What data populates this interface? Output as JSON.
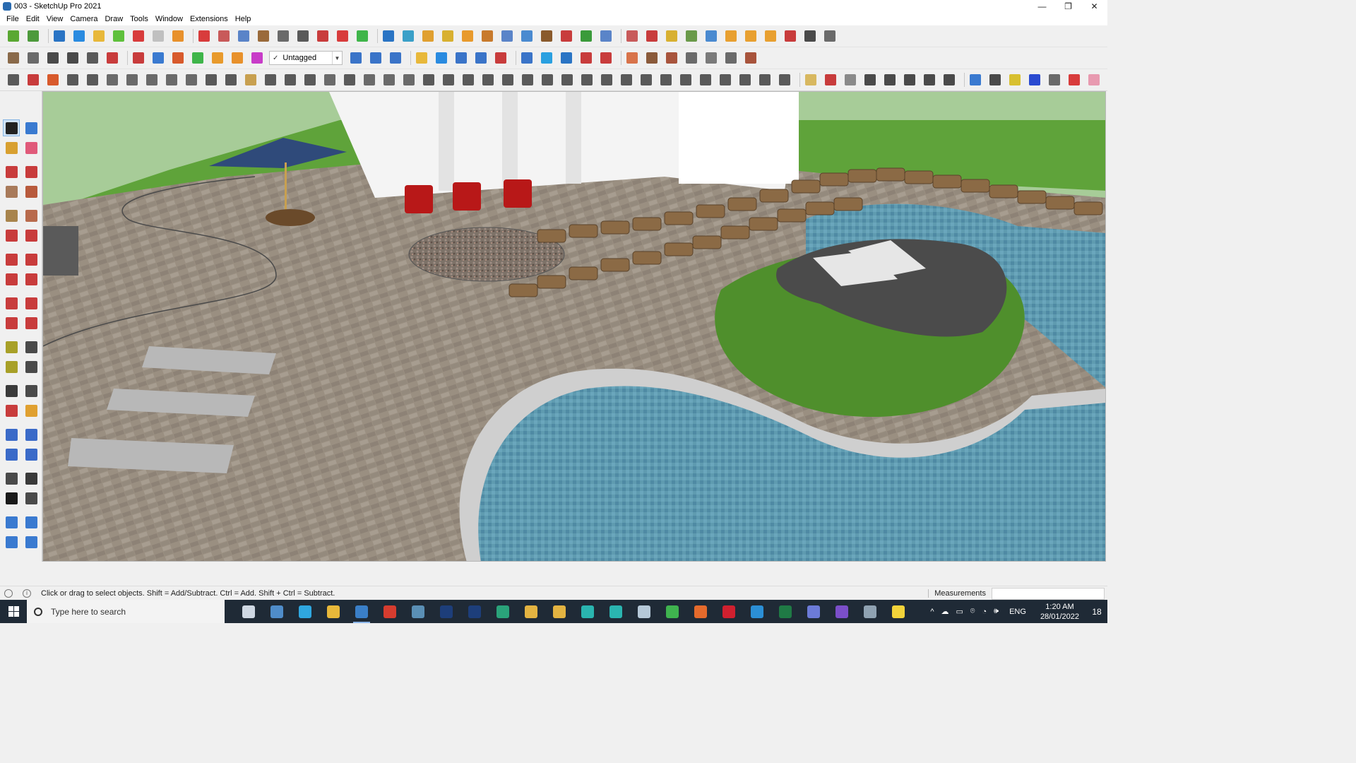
{
  "window": {
    "title": "003 - SketchUp Pro 2021",
    "minimize_glyph": "—",
    "maximize_glyph": "❐",
    "close_glyph": "✕"
  },
  "menu": [
    "File",
    "Edit",
    "View",
    "Camera",
    "Draw",
    "Tools",
    "Window",
    "Extensions",
    "Help"
  ],
  "tag_select": {
    "check": "✓",
    "value": "Untagged",
    "arrow": "▼"
  },
  "status": {
    "info_glyph": "i",
    "message": "Click or drag to select objects. Shift = Add/Subtract. Ctrl = Add. Shift + Ctrl = Subtract.",
    "measurements_label": "Measurements",
    "measurements_value": ""
  },
  "taskbar": {
    "search_placeholder": "Type here to search",
    "language": "ENG",
    "time": "1:20 AM",
    "date": "28/01/2022",
    "notification_count": "18",
    "tray_glyphs": [
      "^",
      "☁",
      "▭",
      "⌾",
      "◔",
      "🕪"
    ],
    "apps": [
      {
        "name": "task-view",
        "color": "#cfd8e3"
      },
      {
        "name": "calculator",
        "color": "#4f8cc9"
      },
      {
        "name": "edge",
        "color": "#2fa7e0"
      },
      {
        "name": "file-explorer",
        "color": "#e8b83a"
      },
      {
        "name": "sketchup",
        "color": "#3a7fc8",
        "active": true
      },
      {
        "name": "acrobat",
        "color": "#d63c2f"
      },
      {
        "name": "app-blue",
        "color": "#5a8fb5"
      },
      {
        "name": "photoshop",
        "color": "#1d3e7a"
      },
      {
        "name": "photoshop-2",
        "color": "#1d3e7a"
      },
      {
        "name": "app-green",
        "color": "#2aa37a"
      },
      {
        "name": "chrome",
        "color": "#e3b341"
      },
      {
        "name": "chrome-2",
        "color": "#e3b341"
      },
      {
        "name": "app-teal",
        "color": "#2ab5b0"
      },
      {
        "name": "app-3",
        "color": "#2ab5b0"
      },
      {
        "name": "notes",
        "color": "#b5c8d8"
      },
      {
        "name": "whatsapp",
        "color": "#3fb34f"
      },
      {
        "name": "grammarly",
        "color": "#e46a2c"
      },
      {
        "name": "opera",
        "color": "#d0202f"
      },
      {
        "name": "vscode",
        "color": "#2b8fd6"
      },
      {
        "name": "excel",
        "color": "#1f7a45"
      },
      {
        "name": "discord",
        "color": "#6c7bd8"
      },
      {
        "name": "podcast",
        "color": "#7b4fc9"
      },
      {
        "name": "app-gray",
        "color": "#8fa2b2"
      },
      {
        "name": "sticky-notes",
        "color": "#f2d33a"
      }
    ]
  },
  "toolbar1_icons": [
    "#5aa832",
    "#4d9a3c",
    "#2a74c4",
    "#2a8be0",
    "#e8b83a",
    "#5fc03c",
    "#d83c3c",
    "#c0c0c0",
    "#e8912c",
    "#d83c3c",
    "#c85a5a",
    "#5a84c8",
    "#9a6a3a",
    "#6a6a6a",
    "#5a5a5a",
    "#c83c3c",
    "#d83c3c",
    "#3fb54a",
    "#2a74c4",
    "#3aa0c8",
    "#e0a030",
    "#d8b030",
    "#e89a2c",
    "#c87a2c",
    "#5a84c8",
    "#4a8ad0",
    "#8a5a2c",
    "#c83c3c",
    "#3a9a3a",
    "#5a84c8",
    "#c85a5a",
    "#c83c3c",
    "#d8b030",
    "#6a9a4a",
    "#4a8ad0",
    "#e8a030",
    "#e8a030",
    "#e8a030",
    "#c83c3c",
    "#4a4a4a",
    "#6a6a6a"
  ],
  "toolbar2_icons_left": [
    "#8a6a4a",
    "#6a6a6a",
    "#4a4a4a",
    "#4a4a4a",
    "#5a5a5a",
    "#c83c3c",
    "#c83c3c",
    "#3a7ad0",
    "#d85a2c",
    "#3fb54a",
    "#e89a2c",
    "#e8912c",
    "#c83cc8"
  ],
  "toolbar2_icons_right": [
    "#3a74c8",
    "#3a74c8",
    "#3a74c8",
    "#e8b83a",
    "#2a8be0",
    "#3a74c8",
    "#3a74c8",
    "#c83c3c",
    "#3a74c8",
    "#2aa0e0",
    "#2a74c4",
    "#c83c3c",
    "#c83c3c",
    "#d8734a",
    "#8a5a3a",
    "#a8543c",
    "#6a6a6a",
    "#7a7a7a",
    "#6a6a6a",
    "#a8543c"
  ],
  "toolbar3_icons": [
    "#5a5a5a",
    "#c83c3c",
    "#d85a2c",
    "#5a5a5a",
    "#5a5a5a",
    "#6a6a6a",
    "#6a6a6a",
    "#6a6a6a",
    "#6a6a6a",
    "#6a6a6a",
    "#5a5a5a",
    "#5a5a5a",
    "#c8a050",
    "#5a5a5a",
    "#5a5a5a",
    "#5a5a5a",
    "#6a6a6a",
    "#5a5a5a",
    "#6a6a6a",
    "#6a6a6a",
    "#6a6a6a",
    "#5a5a5a",
    "#5a5a5a",
    "#5a5a5a",
    "#5a5a5a",
    "#5a5a5a",
    "#5a5a5a",
    "#5a5a5a",
    "#5a5a5a",
    "#5a5a5a",
    "#5a5a5a",
    "#5a5a5a",
    "#5a5a5a",
    "#5a5a5a",
    "#5a5a5a",
    "#5a5a5a",
    "#5a5a5a",
    "#5a5a5a",
    "#5a5a5a",
    "#5a5a5a",
    "#d8b860",
    "#c83c3c",
    "#8a8a8a",
    "#4a4a4a",
    "#4a4a4a",
    "#4a4a4a",
    "#4a4a4a",
    "#4a4a4a",
    "#3a7ad0",
    "#4a4a4a",
    "#d8c030",
    "#2a4ad0",
    "#6a6a6a",
    "#d83c3c",
    "#e89ab0"
  ],
  "palette_icons": [
    "#222222",
    "#3a7ad0",
    "#d8a030",
    "#e05a7a",
    "#c83c3c",
    "#c83c3c",
    "#a87a5a",
    "#b85a3c",
    "#a8844c",
    "#b86a4c",
    "#c83c3c",
    "#c83c3c",
    "#c83c3c",
    "#c83c3c",
    "#c83c3c",
    "#c83c3c",
    "#c83c3c",
    "#c83c3c",
    "#c83c3c",
    "#c83c3c",
    "#a8a028",
    "#4a4a4a",
    "#a8a028",
    "#4a4a4a",
    "#3a3a3a",
    "#4a4a4a",
    "#c83c3c",
    "#e0a030",
    "#3a6ac8",
    "#3a6ac8",
    "#3a6ac8",
    "#3a6ac8",
    "#4a4a4a",
    "#3a3a3a",
    "#1a1a1a",
    "#4a4a4a",
    "#3a7ad0",
    "#3a7ad0",
    "#3a7ad0",
    "#3a7ad0"
  ],
  "scene_colors": {
    "sky": "#a7cc98",
    "grass_far": "#5fa33a",
    "paver": "#9a8f81",
    "pool_water": "#5f9bb0",
    "pool_deep": "#3c7494",
    "pool_coping": "#cfcfcf",
    "lawn": "#4f8f2c",
    "island_dark": "#4b4b4b",
    "stone": "#8b6a45",
    "gravel": "#7d7268",
    "house_wall": "#f4f4f4",
    "chair_red": "#b81818",
    "umbrella": "#2f4a7a",
    "lounger": "#b8b8b8",
    "wood": "#6a4a2a"
  }
}
